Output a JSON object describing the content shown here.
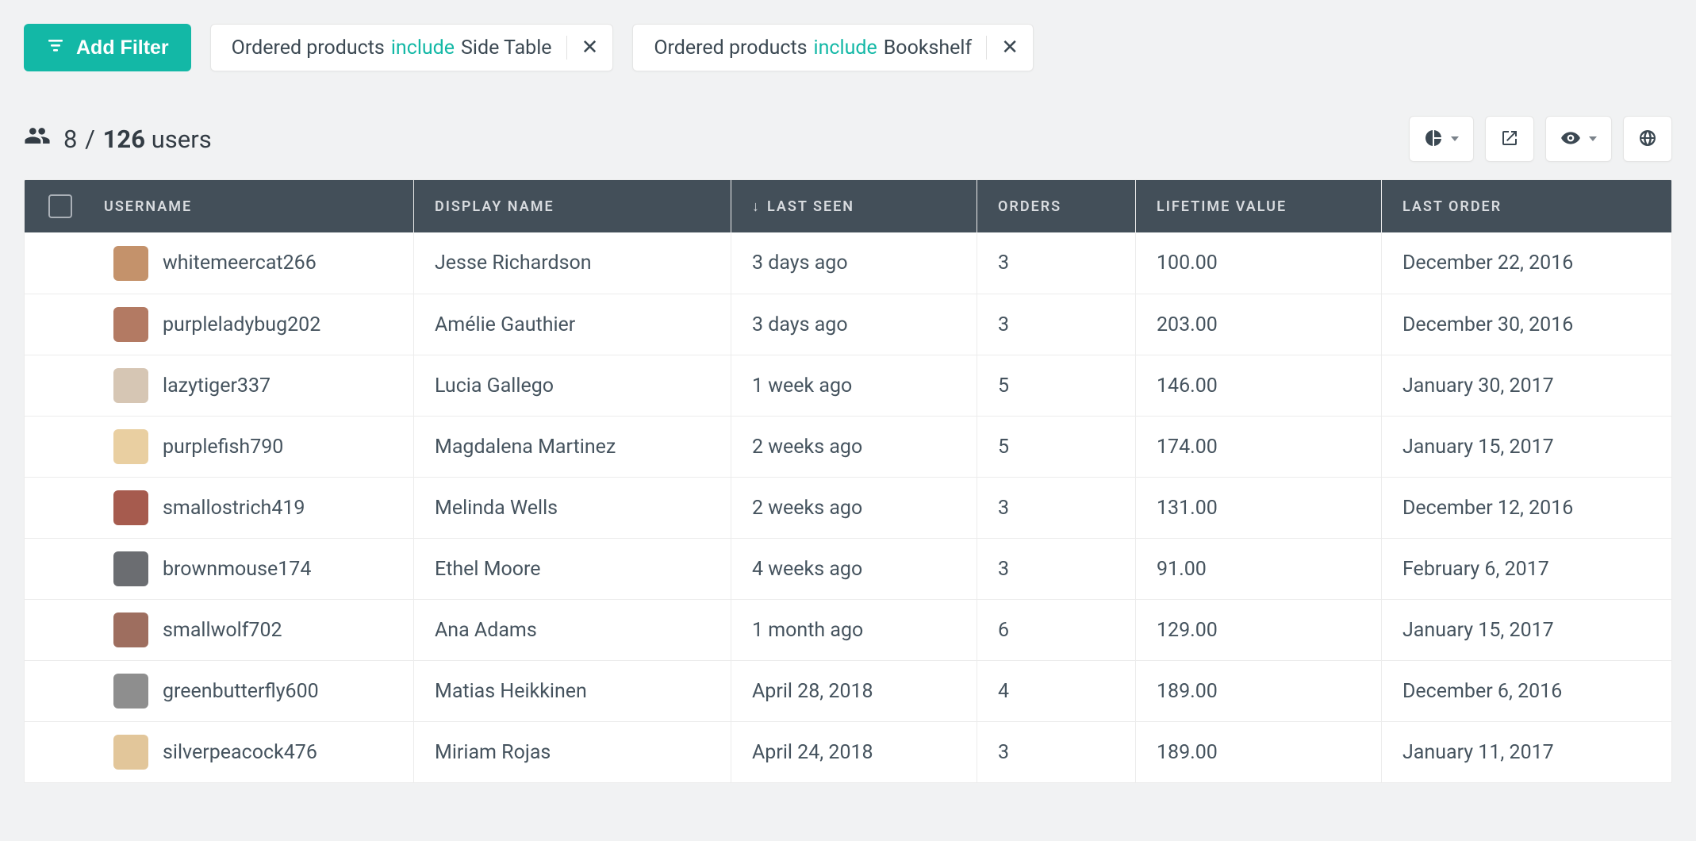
{
  "filters": {
    "add_label": "Add Filter",
    "chips": [
      {
        "field": "Ordered products",
        "operator": "include",
        "value": "Side Table"
      },
      {
        "field": "Ordered products",
        "operator": "include",
        "value": "Bookshelf"
      }
    ]
  },
  "summary": {
    "shown": "8",
    "total": "126",
    "label": "users"
  },
  "columns": {
    "username": "USERNAME",
    "display_name": "DISPLAY NAME",
    "last_seen": "LAST SEEN",
    "orders": "ORDERS",
    "lifetime_value": "LIFETIME VALUE",
    "last_order": "LAST ORDER",
    "sort_indicator": "↓"
  },
  "rows": [
    {
      "username": "whitemeercat266",
      "display_name": "Jesse Richardson",
      "last_seen": "3 days ago",
      "orders": "3",
      "lifetime_value": "100.00",
      "last_order": "December 22, 2016",
      "avatar": "#c4926b"
    },
    {
      "username": "purpleladybug202",
      "display_name": "Amélie Gauthier",
      "last_seen": "3 days ago",
      "orders": "3",
      "lifetime_value": "203.00",
      "last_order": "December 30, 2016",
      "avatar": "#b37a63"
    },
    {
      "username": "lazytiger337",
      "display_name": "Lucia Gallego",
      "last_seen": "1 week ago",
      "orders": "5",
      "lifetime_value": "146.00",
      "last_order": "January 30, 2017",
      "avatar": "#d6c6b4"
    },
    {
      "username": "purplefish790",
      "display_name": "Magdalena Martinez",
      "last_seen": "2 weeks ago",
      "orders": "5",
      "lifetime_value": "174.00",
      "last_order": "January 15, 2017",
      "avatar": "#e9cfa1"
    },
    {
      "username": "smallostrich419",
      "display_name": "Melinda Wells",
      "last_seen": "2 weeks ago",
      "orders": "3",
      "lifetime_value": "131.00",
      "last_order": "December 12, 2016",
      "avatar": "#a65b4e"
    },
    {
      "username": "brownmouse174",
      "display_name": "Ethel Moore",
      "last_seen": "4 weeks ago",
      "orders": "3",
      "lifetime_value": "91.00",
      "last_order": "February 6, 2017",
      "avatar": "#6b6d71"
    },
    {
      "username": "smallwolf702",
      "display_name": "Ana Adams",
      "last_seen": "1 month ago",
      "orders": "6",
      "lifetime_value": "129.00",
      "last_order": "January 15, 2017",
      "avatar": "#9e6e5f"
    },
    {
      "username": "greenbutterfly600",
      "display_name": "Matias Heikkinen",
      "last_seen": "April 28, 2018",
      "orders": "4",
      "lifetime_value": "189.00",
      "last_order": "December 6, 2016",
      "avatar": "#8e8e8e"
    },
    {
      "username": "silverpeacock476",
      "display_name": "Miriam Rojas",
      "last_seen": "April 24, 2018",
      "orders": "3",
      "lifetime_value": "189.00",
      "last_order": "January 11, 2017",
      "avatar": "#e2c69a"
    }
  ]
}
